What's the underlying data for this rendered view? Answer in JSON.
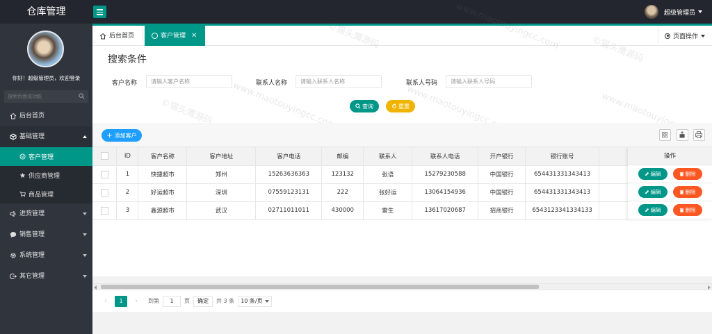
{
  "header": {
    "app_title": "仓库管理",
    "user_name": "超级管理员"
  },
  "sidebar": {
    "welcome": "你好！超级管理员，欢迎登录",
    "search_placeholder": "搜索页面或功能",
    "items": [
      {
        "label": "后台首页",
        "icon": "home-icon"
      },
      {
        "label": "基础管理",
        "icon": "cube-icon",
        "expanded": true,
        "children": [
          {
            "label": "客户管理",
            "icon": "circle-icon",
            "active": true
          },
          {
            "label": "供应商管理",
            "icon": "star-icon"
          },
          {
            "label": "商品管理",
            "icon": "cart-icon"
          }
        ]
      },
      {
        "label": "进货管理",
        "icon": "speaker-icon"
      },
      {
        "label": "销售管理",
        "icon": "chat-icon"
      },
      {
        "label": "系统管理",
        "icon": "gear-icon"
      },
      {
        "label": "其它管理",
        "icon": "logout-icon"
      }
    ]
  },
  "tabs": {
    "home_label": "后台首页",
    "active_label": "客户管理",
    "page_ops_label": "页面操作"
  },
  "search": {
    "title": "搜索条件",
    "fields": [
      {
        "label": "客户名称",
        "placeholder": "请输入客户名称"
      },
      {
        "label": "联系人名称",
        "placeholder": "请输入联系人名称"
      },
      {
        "label": "联系人号码",
        "placeholder": "请输入联系人号码"
      }
    ],
    "query_label": "查询",
    "reset_label": "重置"
  },
  "toolbar": {
    "add_label": "添加客户"
  },
  "table": {
    "columns": [
      "ID",
      "客户名称",
      "客户地址",
      "客户电话",
      "邮编",
      "联系人",
      "联系人电话",
      "开户银行",
      "银行账号",
      "操作"
    ],
    "rows": [
      {
        "id": "1",
        "name": "快捷超市",
        "address": "郑州",
        "phone": "15263636363",
        "zip": "123132",
        "contact": "张语",
        "contact_phone": "15279230588",
        "bank": "中国银行",
        "account": "654431331343413"
      },
      {
        "id": "2",
        "name": "好运超市",
        "address": "深圳",
        "phone": "07559123131",
        "zip": "222",
        "contact": "张好运",
        "contact_phone": "13064154936",
        "bank": "中国银行",
        "account": "654431331343413"
      },
      {
        "id": "3",
        "name": "鑫源超市",
        "address": "武汉",
        "phone": "02711011011",
        "zip": "430000",
        "contact": "雷生",
        "contact_phone": "13617020687",
        "bank": "招商银行",
        "account": "6543123341334133"
      }
    ],
    "edit_label": "编辑",
    "delete_label": "删除"
  },
  "pager": {
    "current_page": "1",
    "goto_prefix": "到第",
    "goto_value": "1",
    "goto_suffix": "页",
    "confirm_label": "确定",
    "total_label": "共 3 条",
    "page_size_label": "10 条/页"
  },
  "watermark": {
    "line1": "©猫头鹰源码",
    "line2": "www.maotouyingcc.com"
  },
  "colors": {
    "primary": "#009688",
    "warning": "#f0b400",
    "danger": "#ff5722",
    "info": "#1e9fff",
    "sidebar_bg": "#2f343d",
    "header_bg": "#23262e"
  }
}
